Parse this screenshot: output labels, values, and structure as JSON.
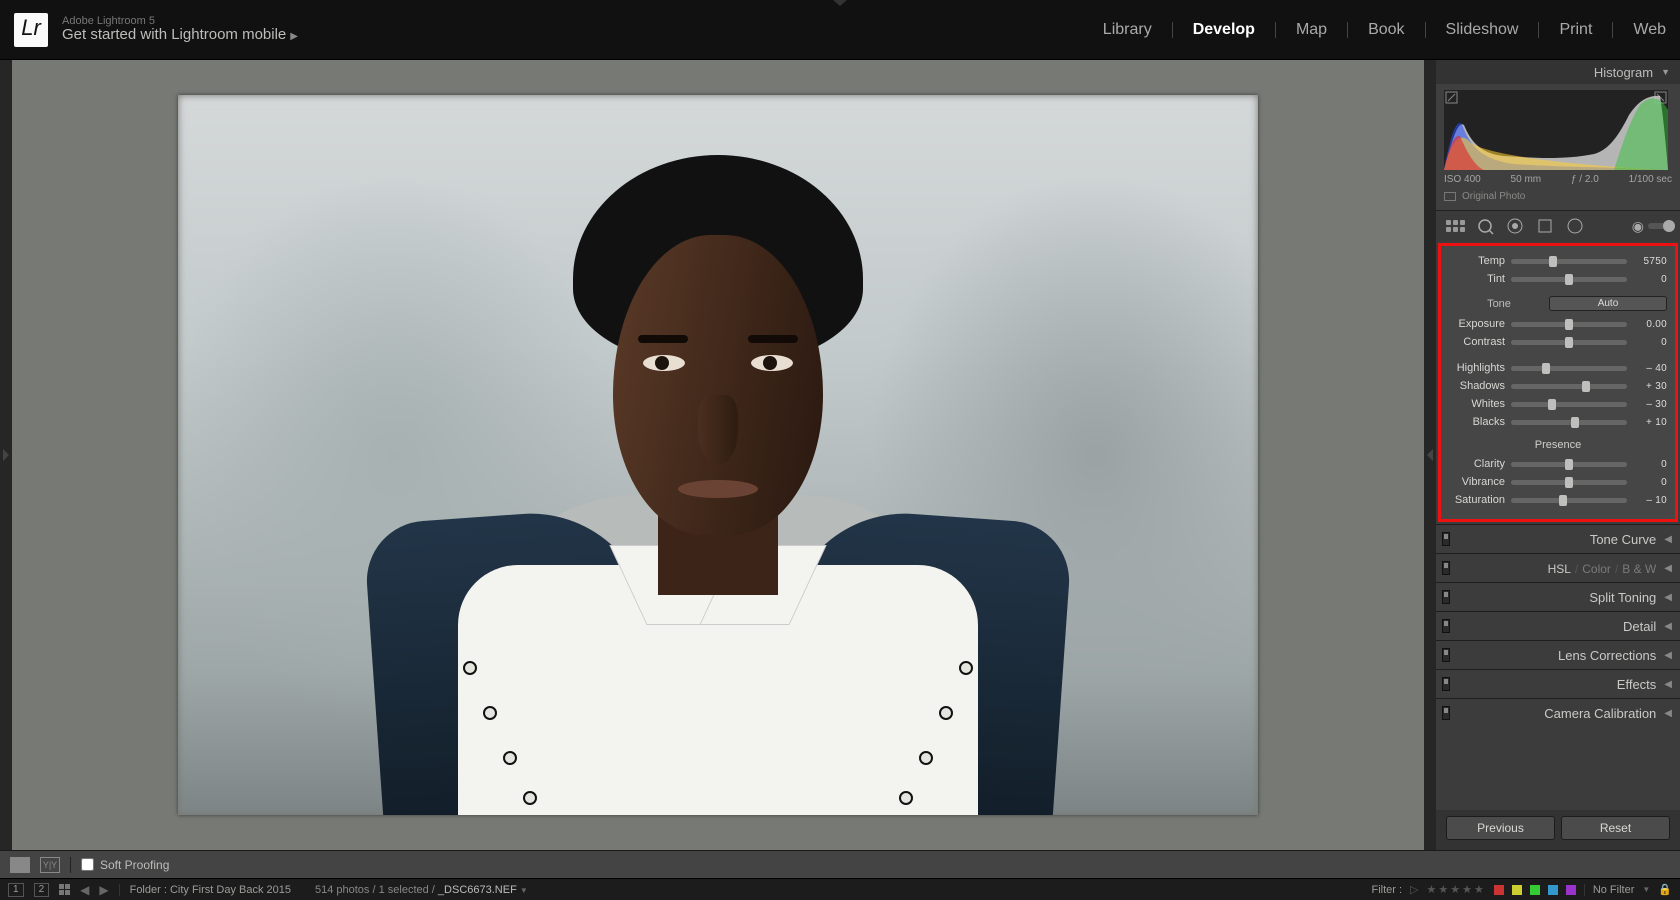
{
  "top": {
    "version": "Adobe Lightroom 5",
    "subtitle": "Get started with Lightroom mobile",
    "modules": [
      "Library",
      "Develop",
      "Map",
      "Book",
      "Slideshow",
      "Print",
      "Web"
    ],
    "active": "Develop"
  },
  "histogram": {
    "title": "Histogram",
    "iso": "ISO 400",
    "focal": "50 mm",
    "aperture": "ƒ / 2.0",
    "shutter": "1/100 sec",
    "original": "Original Photo"
  },
  "basic": {
    "wb": {
      "temp": {
        "label": "Temp",
        "value": "5750",
        "pos": 36
      },
      "tint": {
        "label": "Tint",
        "value": "0",
        "pos": 50
      }
    },
    "tone": {
      "title": "Tone",
      "auto": "Auto",
      "exposure": {
        "label": "Exposure",
        "value": "0.00",
        "pos": 50
      },
      "contrast": {
        "label": "Contrast",
        "value": "0",
        "pos": 50
      },
      "highlights": {
        "label": "Highlights",
        "value": "– 40",
        "pos": 30
      },
      "shadows": {
        "label": "Shadows",
        "value": "+ 30",
        "pos": 65
      },
      "whites": {
        "label": "Whites",
        "value": "– 30",
        "pos": 35
      },
      "blacks": {
        "label": "Blacks",
        "value": "+ 10",
        "pos": 55
      }
    },
    "presence": {
      "title": "Presence",
      "clarity": {
        "label": "Clarity",
        "value": "0",
        "pos": 50
      },
      "vibrance": {
        "label": "Vibrance",
        "value": "0",
        "pos": 50
      },
      "saturation": {
        "label": "Saturation",
        "value": "– 10",
        "pos": 45
      }
    }
  },
  "panels": {
    "tone_curve": "Tone Curve",
    "hsl": "HSL",
    "color": "Color",
    "bw": "B & W",
    "split": "Split Toning",
    "detail": "Detail",
    "lens": "Lens Corrections",
    "effects": "Effects",
    "calib": "Camera Calibration"
  },
  "buttons": {
    "previous": "Previous",
    "reset": "Reset"
  },
  "under": {
    "soft": "Soft Proofing"
  },
  "status": {
    "folder": "Folder : City First Day Back 2015",
    "count": "514 photos / 1 selected /",
    "file": "_DSC6673.NEF",
    "filter": "Filter :",
    "nofilter": "No Filter",
    "m1": "1",
    "m2": "2"
  }
}
